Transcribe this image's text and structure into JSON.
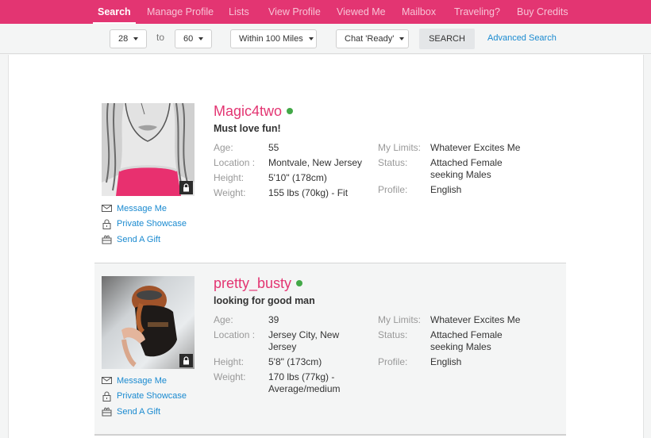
{
  "nav": {
    "items": [
      {
        "label": "Search",
        "active": true
      },
      {
        "label": "Manage Profile"
      },
      {
        "label": "Lists"
      },
      {
        "label": "View Profile"
      },
      {
        "label": "Viewed Me"
      },
      {
        "label": "Mailbox"
      },
      {
        "label": "Traveling?"
      },
      {
        "label": "Buy Credits"
      }
    ]
  },
  "filters": {
    "age_from": "28",
    "to_label": "to",
    "age_to": "60",
    "distance": "Within 100 Miles",
    "chat": "Chat 'Ready'",
    "search_label": "SEARCH",
    "advanced_label": "Advanced Search"
  },
  "colors": {
    "brand": "#e33572",
    "link": "#1a8ad0",
    "online": "#43a848"
  },
  "profiles": [
    {
      "username": "Magic4two",
      "online": true,
      "tagline": "Must love fun!",
      "photo_icon": "illustrated-woman-placeholder",
      "locked": true,
      "labels": {
        "age": "Age:",
        "location": "Location :",
        "height": "Height:",
        "weight": "Weight:",
        "limits": "My Limits:",
        "status": "Status:",
        "profile": "Profile:"
      },
      "age": "55",
      "location": "Montvale, New Jersey",
      "height": "5'10\" (178cm)",
      "weight": "155 lbs (70kg) - Fit",
      "limits": "Whatever Excites Me",
      "status": "Attached Female seeking Males",
      "profile": "English",
      "actions": [
        "Message Me",
        "Private Showcase",
        "Send A Gift"
      ]
    },
    {
      "username": "pretty_busty",
      "online": true,
      "tagline": "looking for good man",
      "photo_icon": "user-photo",
      "locked": true,
      "labels": {
        "age": "Age:",
        "location": "Location :",
        "height": "Height:",
        "weight": "Weight:",
        "limits": "My Limits:",
        "status": "Status:",
        "profile": "Profile:"
      },
      "age": "39",
      "location": "Jersey City, New Jersey",
      "height": "5'8\" (173cm)",
      "weight": "170 lbs (77kg) - Average/medium",
      "limits": "Whatever Excites Me",
      "status": "Attached Female seeking Males",
      "profile": "English",
      "actions": [
        "Message Me",
        "Private Showcase",
        "Send A Gift"
      ]
    }
  ]
}
